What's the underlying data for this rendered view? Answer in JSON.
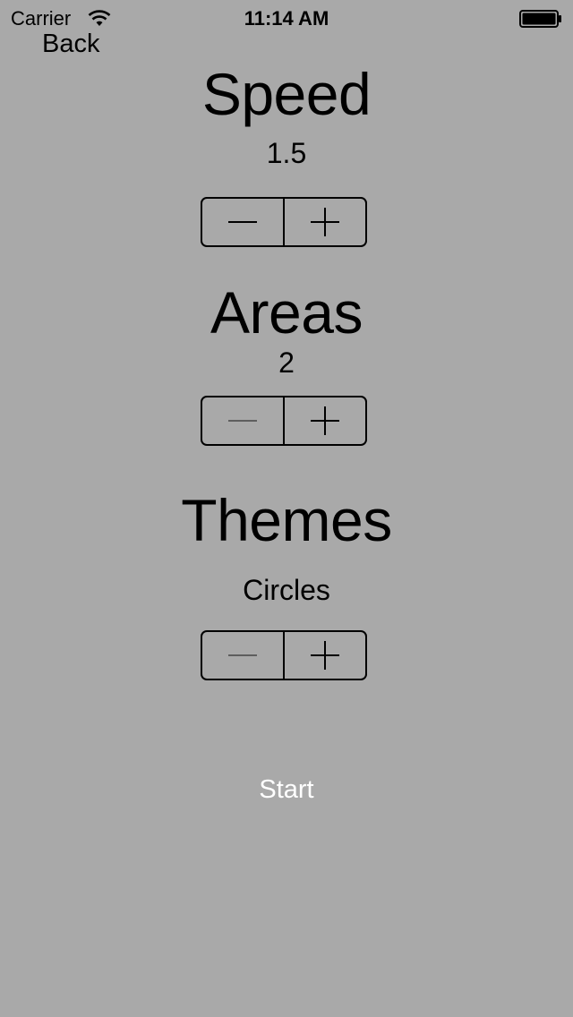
{
  "status_bar": {
    "carrier": "Carrier",
    "time": "11:14 AM"
  },
  "nav": {
    "back_label": "Back"
  },
  "speed": {
    "title": "Speed",
    "value": "1.5",
    "decrement_enabled": true,
    "increment_enabled": true
  },
  "areas": {
    "title": "Areas",
    "value": "2",
    "decrement_enabled": false,
    "increment_enabled": true
  },
  "themes": {
    "title": "Themes",
    "value": "Circles",
    "decrement_enabled": false,
    "increment_enabled": true
  },
  "start": {
    "label": "Start"
  },
  "colors": {
    "background": "#a9a9a9",
    "text": "#000000",
    "start_text": "#ffffff",
    "disabled_glyph": "#5e5e5e"
  },
  "icons": {
    "wifi": "wifi-icon",
    "battery": "battery-icon",
    "minus": "minus-icon",
    "plus": "plus-icon"
  }
}
